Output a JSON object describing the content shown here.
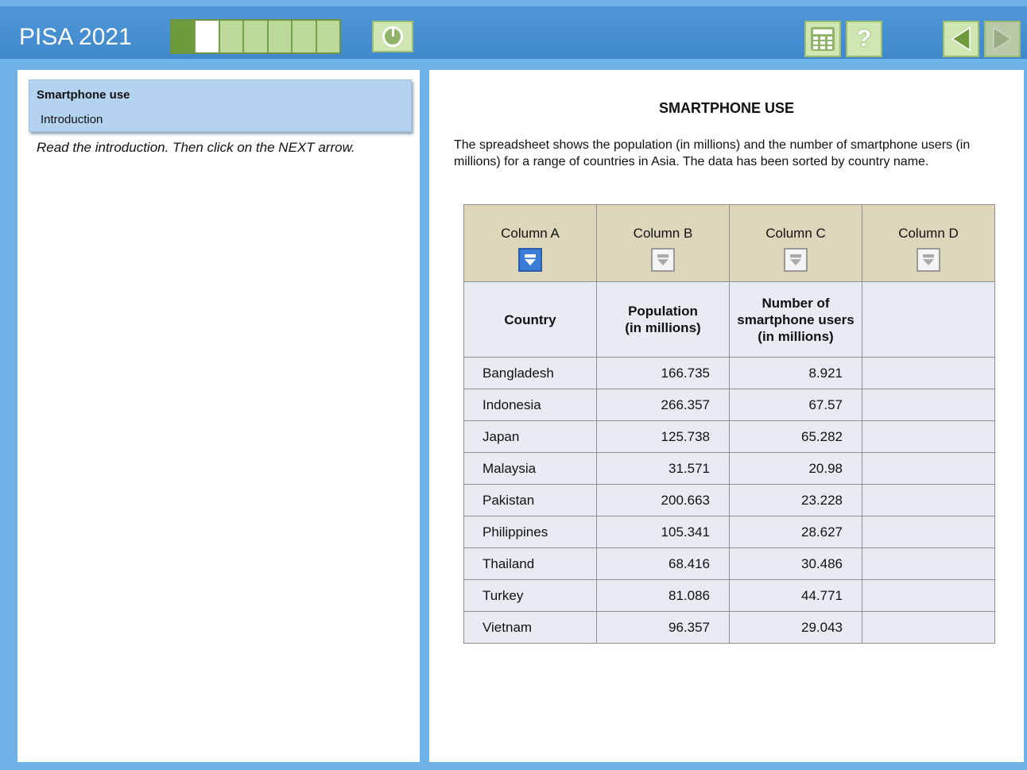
{
  "app": {
    "title": "PISA 2021"
  },
  "progress": {
    "segments": [
      "done",
      "current",
      "todo",
      "todo",
      "todo",
      "todo",
      "todo"
    ]
  },
  "toolbar": {
    "timer_icon": "clock-icon",
    "calculator_icon": "calculator-icon",
    "help_label": "?",
    "back_icon": "left-arrow-icon",
    "next_icon": "right-arrow-icon"
  },
  "sidebar": {
    "tab_title": "Smartphone use",
    "tab_subtitle": "Introduction",
    "instruction": "Read the introduction. Then click on the NEXT arrow."
  },
  "main": {
    "heading": "SMARTPHONE USE",
    "intro": "The spreadsheet shows the population (in millions) and the number of smartphone users (in millions) for a range of countries in Asia. The data has been sorted by country name."
  },
  "spreadsheet": {
    "columns": [
      {
        "label": "Column A",
        "header": "Country",
        "active": true
      },
      {
        "label": "Column B",
        "header": "Population\n(in millions)",
        "active": false
      },
      {
        "label": "Column C",
        "header": "Number of\nsmartphone users\n(in millions)",
        "active": false
      },
      {
        "label": "Column D",
        "header": "",
        "active": false
      }
    ],
    "rows": [
      [
        "Bangladesh",
        "166.735",
        "8.921",
        ""
      ],
      [
        "Indonesia",
        "266.357",
        "67.57",
        ""
      ],
      [
        "Japan",
        "125.738",
        "65.282",
        ""
      ],
      [
        "Malaysia",
        "31.571",
        "20.98",
        ""
      ],
      [
        "Pakistan",
        "200.663",
        "23.228",
        ""
      ],
      [
        "Philippines",
        "105.341",
        "28.627",
        ""
      ],
      [
        "Thailand",
        "68.416",
        "30.486",
        ""
      ],
      [
        "Turkey",
        "81.086",
        "44.771",
        ""
      ],
      [
        "Vietnam",
        "96.357",
        "29.043",
        ""
      ]
    ]
  },
  "colors": {
    "topbar": "#4a93d3",
    "accent_green": "#cfe6b2",
    "header_tan": "#ded6bb",
    "cell_bg": "#e7ecf3"
  }
}
